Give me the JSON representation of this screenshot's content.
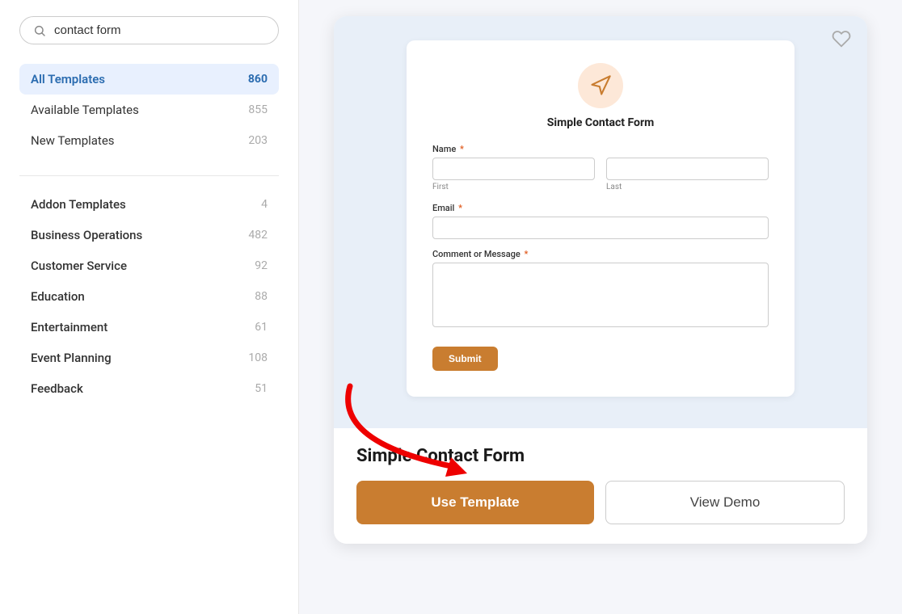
{
  "search": {
    "placeholder": "contact form",
    "value": "contact form"
  },
  "sidebar": {
    "filters": [
      {
        "label": "All Templates",
        "count": "860",
        "active": true
      },
      {
        "label": "Available Templates",
        "count": "855",
        "active": false
      },
      {
        "label": "New Templates",
        "count": "203",
        "active": false
      }
    ],
    "categories": [
      {
        "label": "Addon Templates",
        "count": "4"
      },
      {
        "label": "Business Operations",
        "count": "482"
      },
      {
        "label": "Customer Service",
        "count": "92"
      },
      {
        "label": "Education",
        "count": "88"
      },
      {
        "label": "Entertainment",
        "count": "61"
      },
      {
        "label": "Event Planning",
        "count": "108"
      },
      {
        "label": "Feedback",
        "count": "51"
      }
    ]
  },
  "template": {
    "title": "Simple Contact Form",
    "form": {
      "icon_label": "megaphone-icon",
      "title": "Simple Contact Form",
      "name_label": "Name",
      "name_required": "*",
      "first_label": "First",
      "last_label": "Last",
      "email_label": "Email",
      "email_required": "*",
      "message_label": "Comment or Message",
      "message_required": "*",
      "submit_label": "Submit"
    },
    "use_template_label": "Use Template",
    "view_demo_label": "View Demo"
  },
  "icons": {
    "heart": "♡",
    "search": "🔍"
  }
}
